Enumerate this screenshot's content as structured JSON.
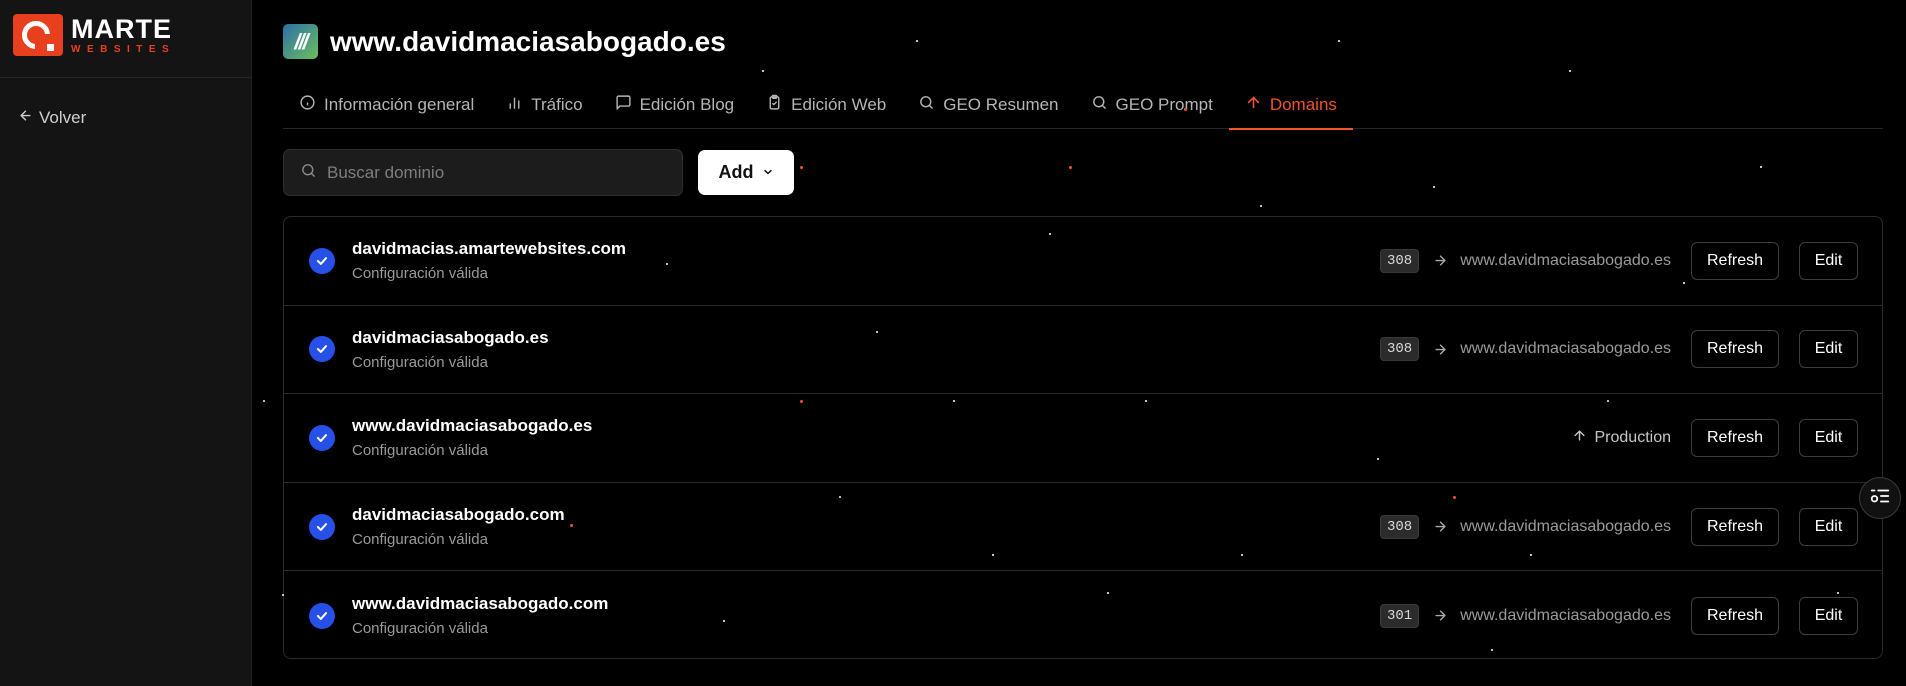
{
  "brand": {
    "line1": "MARTE",
    "line2": "WEBSITES",
    "accent": "#e8401f"
  },
  "sidebar": {
    "back_label": "Volver"
  },
  "site": {
    "icon_text": "///",
    "title": "www.davidmaciasabogado.es"
  },
  "tabs": [
    {
      "label": "Información general",
      "icon": "info-icon"
    },
    {
      "label": "Tráfico",
      "icon": "bar-chart-icon"
    },
    {
      "label": "Edición Blog",
      "icon": "message-icon"
    },
    {
      "label": "Edición Web",
      "icon": "clipboard-icon"
    },
    {
      "label": "GEO Resumen",
      "icon": "search-icon"
    },
    {
      "label": "GEO Prompt",
      "icon": "search-icon"
    },
    {
      "label": "Domains",
      "icon": "arrow-up-icon",
      "active": true
    }
  ],
  "toolbar": {
    "search_placeholder": "Buscar dominio",
    "add_label": "Add"
  },
  "domains": [
    {
      "name": "davidmacias.amartewebsites.com",
      "status": "Configuración válida",
      "code": "308",
      "target": "www.davidmaciasabogado.es",
      "refresh": "Refresh",
      "edit": "Edit"
    },
    {
      "name": "davidmaciasabogado.es",
      "status": "Configuración válida",
      "code": "308",
      "target": "www.davidmaciasabogado.es",
      "refresh": "Refresh",
      "edit": "Edit"
    },
    {
      "name": "www.davidmaciasabogado.es",
      "status": "Configuración válida",
      "production": "Production",
      "refresh": "Refresh",
      "edit": "Edit"
    },
    {
      "name": "davidmaciasabogado.com",
      "status": "Configuración válida",
      "code": "308",
      "target": "www.davidmaciasabogado.es",
      "refresh": "Refresh",
      "edit": "Edit"
    },
    {
      "name": "www.davidmaciasabogado.com",
      "status": "Configuración válida",
      "code": "301",
      "target": "www.davidmaciasabogado.es",
      "refresh": "Refresh",
      "edit": "Edit"
    }
  ],
  "colors": {
    "accent": "#f0532d",
    "check": "#2650e8",
    "background": "#000000",
    "sidebar": "#141414"
  }
}
